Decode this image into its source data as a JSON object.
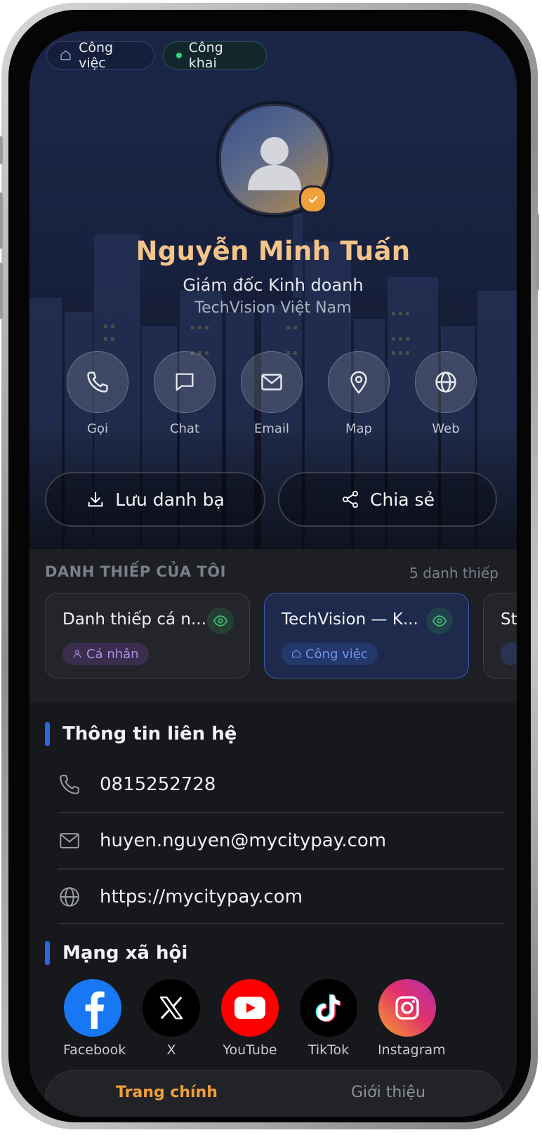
{
  "chips": {
    "work": "Công việc",
    "public": "Công khai"
  },
  "profile": {
    "name": "Nguyễn Minh Tuấn",
    "title": "Giám đốc Kinh doanh",
    "company": "TechVision Việt Nam"
  },
  "actions": [
    {
      "label": "Gọi",
      "icon": "phone-icon"
    },
    {
      "label": "Chat",
      "icon": "chat-icon"
    },
    {
      "label": "Email",
      "icon": "mail-icon"
    },
    {
      "label": "Map",
      "icon": "map-pin-icon"
    },
    {
      "label": "Web",
      "icon": "globe-icon"
    }
  ],
  "buttons": {
    "save": "Lưu danh bạ",
    "share": "Chia sẻ"
  },
  "cards_section": {
    "title": "DANH THIẾP CỦA TÔI",
    "count": "5 danh thiếp",
    "cards": [
      {
        "title": "Danh thiếp cá n...",
        "tag": "Cá nhân"
      },
      {
        "title": "TechVision — K...",
        "tag": "Công việc"
      },
      {
        "title": "St"
      }
    ]
  },
  "contact": {
    "heading": "Thông tin liên hệ",
    "phone": "0815252728",
    "email": "huyen.nguyen@mycitypay.com",
    "website": "https://mycitypay.com"
  },
  "social": {
    "heading": "Mạng xã hội",
    "items": [
      {
        "label": "Facebook",
        "color": "#1877f2"
      },
      {
        "label": "X",
        "color": "#000000"
      },
      {
        "label": "YouTube",
        "color": "#ff0000"
      },
      {
        "label": "TikTok",
        "color": "#000000"
      },
      {
        "label": "Instagram",
        "color": "#e1306c"
      }
    ]
  },
  "tabbar": {
    "home": "Trang chính",
    "intro": "Giới thiệu"
  },
  "colors": {
    "accent": "#f0a03a",
    "brand_blue": "#2f63e8",
    "name_gold": "#f4c48a"
  }
}
